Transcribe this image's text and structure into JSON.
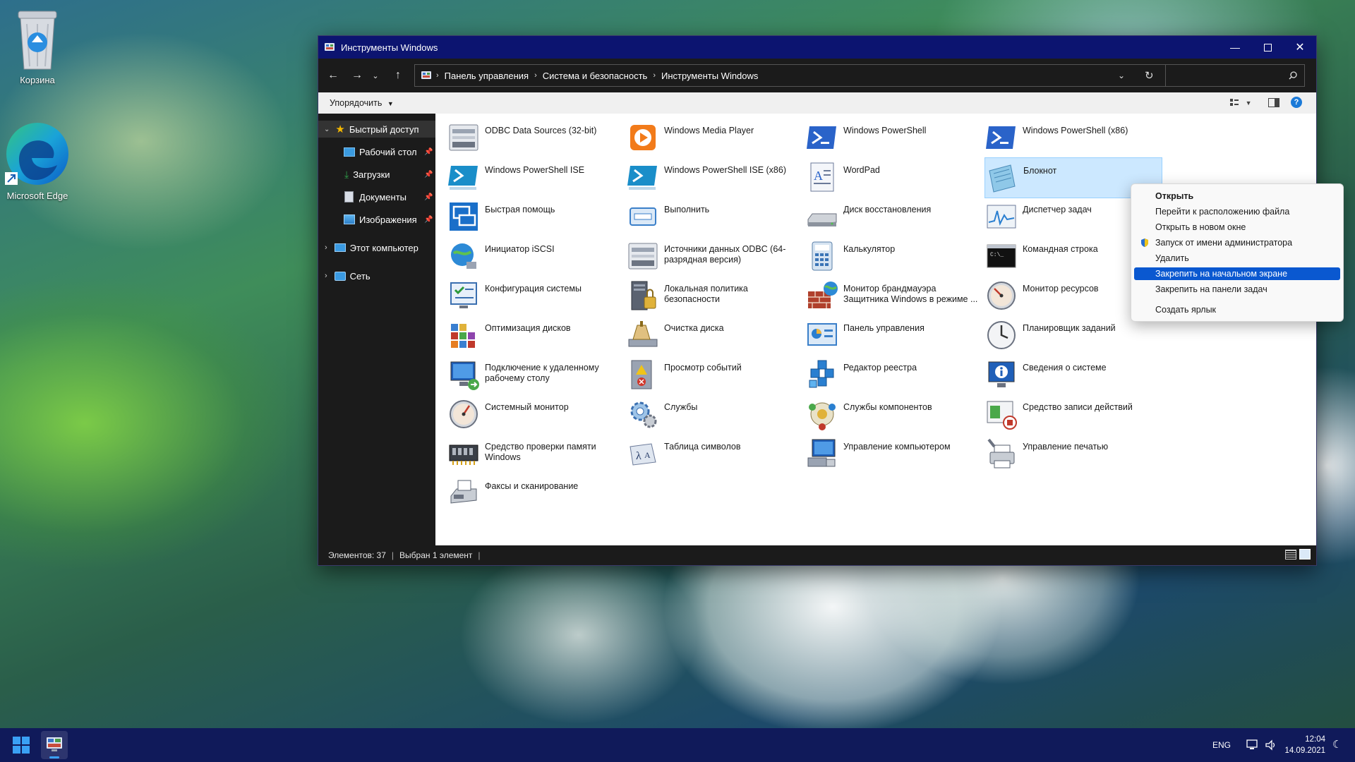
{
  "desktop": {
    "icons": [
      {
        "label": "Корзина"
      },
      {
        "label": "Microsoft Edge"
      }
    ]
  },
  "window": {
    "title": "Инструменты Windows",
    "breadcrumb": [
      "Панель управления",
      "Система и безопасность",
      "Инструменты Windows"
    ],
    "search_placeholder": "",
    "toolbar": {
      "sort_label": "Упорядочить"
    },
    "nav": {
      "quick_access": "Быстрый доступ",
      "items": [
        {
          "label": "Рабочий стол"
        },
        {
          "label": "Загрузки"
        },
        {
          "label": "Документы"
        },
        {
          "label": "Изображения"
        }
      ],
      "this_pc": "Этот компьютер",
      "network": "Сеть"
    },
    "items": [
      {
        "label": "ODBC Data Sources (32-bit)",
        "icon": "odbc-icon"
      },
      {
        "label": "Windows Media Player",
        "icon": "media-player-icon"
      },
      {
        "label": "Windows PowerShell",
        "icon": "powershell-icon"
      },
      {
        "label": "Windows PowerShell (x86)",
        "icon": "powershell-icon"
      },
      {
        "label": "Windows PowerShell ISE",
        "icon": "powershell-ise-icon"
      },
      {
        "label": "Windows PowerShell ISE (x86)",
        "icon": "powershell-ise-icon"
      },
      {
        "label": "WordPad",
        "icon": "wordpad-icon"
      },
      {
        "label": "Блокнот",
        "icon": "notepad-icon"
      },
      {
        "label": "Быстрая помощь",
        "icon": "quick-assist-icon"
      },
      {
        "label": "Выполнить",
        "icon": "run-icon"
      },
      {
        "label": "Диск восстановления",
        "icon": "recovery-drive-icon"
      },
      {
        "label": "Диспетчер задач",
        "icon": "task-manager-icon"
      },
      {
        "label": "Инициатор iSCSI",
        "icon": "iscsi-icon"
      },
      {
        "label": "Источники данных ODBC (64-разрядная версия)",
        "icon": "odbc-icon"
      },
      {
        "label": "Калькулятор",
        "icon": "calculator-icon"
      },
      {
        "label": "Командная строка",
        "icon": "cmd-icon"
      },
      {
        "label": "Конфигурация системы",
        "icon": "msconfig-icon"
      },
      {
        "label": "Локальная политика безопасности",
        "icon": "security-policy-icon"
      },
      {
        "label": "Монитор брандмауэра Защитника Windows в режиме ...",
        "icon": "firewall-icon"
      },
      {
        "label": "Монитор ресурсов",
        "icon": "resource-monitor-icon"
      },
      {
        "label": "Оптимизация дисков",
        "icon": "defrag-icon"
      },
      {
        "label": "Очистка диска",
        "icon": "disk-cleanup-icon"
      },
      {
        "label": "Панель управления",
        "icon": "control-panel-icon"
      },
      {
        "label": "Планировщик заданий",
        "icon": "task-scheduler-icon"
      },
      {
        "label": "Подключение к удаленному рабочему столу",
        "icon": "remote-desktop-icon"
      },
      {
        "label": "Просмотр событий",
        "icon": "event-viewer-icon"
      },
      {
        "label": "Редактор реестра",
        "icon": "registry-icon"
      },
      {
        "label": "Сведения о системе",
        "icon": "system-info-icon"
      },
      {
        "label": "Системный монитор",
        "icon": "perfmon-icon"
      },
      {
        "label": "Службы",
        "icon": "services-icon"
      },
      {
        "label": "Службы компонентов",
        "icon": "component-services-icon"
      },
      {
        "label": "Средство записи действий",
        "icon": "steps-recorder-icon"
      },
      {
        "label": "Средство проверки памяти Windows",
        "icon": "memory-diagnostic-icon"
      },
      {
        "label": "Таблица символов",
        "icon": "charmap-icon"
      },
      {
        "label": "Управление компьютером",
        "icon": "computer-management-icon"
      },
      {
        "label": "Управление печатью",
        "icon": "print-management-icon"
      },
      {
        "label": "Факсы и сканирование",
        "icon": "fax-scan-icon"
      }
    ],
    "selected_item": "Блокнот",
    "status": {
      "count": "Элементов: 37",
      "selected": "Выбран 1 элемент"
    }
  },
  "context_menu": {
    "items": [
      {
        "label": "Открыть",
        "bold": true
      },
      {
        "label": "Перейти к расположению файла"
      },
      {
        "label": "Открыть в новом окне"
      },
      {
        "label": "Запуск от имени администратора",
        "icon": "uac-shield-icon"
      },
      {
        "label": "Удалить"
      },
      {
        "label": "Закрепить на начальном экране",
        "highlighted": true
      },
      {
        "label": "Закрепить на панели задач"
      },
      {
        "label": "Создать ярлык"
      }
    ]
  },
  "taskbar": {
    "language": "ENG",
    "time": "12:04",
    "date": "14.09.2021"
  },
  "colors": {
    "title_bar": "#0c1470",
    "taskbar": "#101a5a",
    "accent": "#0a58d0",
    "selection": "#cce8ff"
  }
}
